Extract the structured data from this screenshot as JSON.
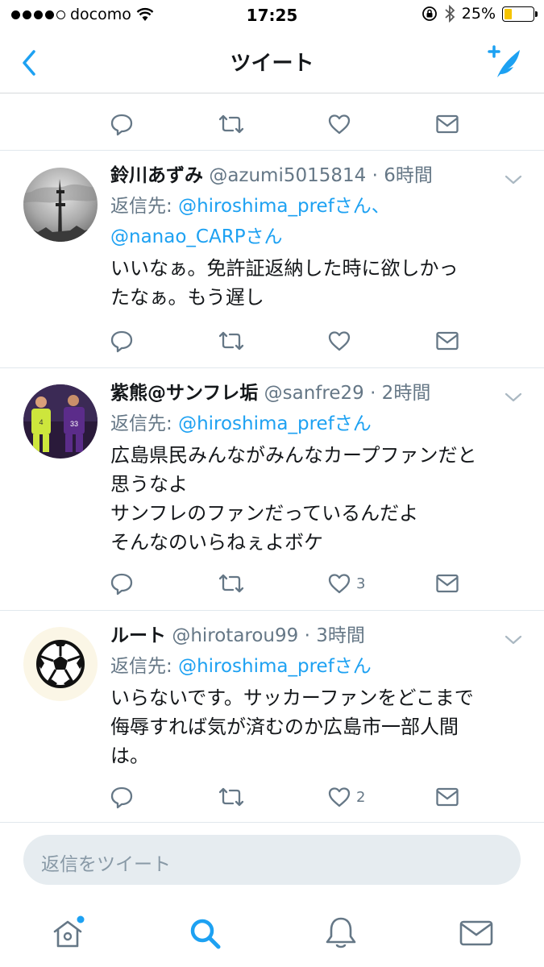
{
  "status_bar": {
    "carrier": "docomo",
    "time": "17:25",
    "battery": "25%",
    "battery_level": 0.25,
    "signal_bars": 4,
    "battery_color": "#f5c400"
  },
  "nav": {
    "title": "ツイート",
    "back_icon": "chevron-left-icon",
    "compose_icon": "compose-tweet-icon"
  },
  "colors": {
    "accent": "#1da1f2",
    "secondary_text": "#657786",
    "primary_text": "#14171a"
  },
  "tweets": [
    {
      "name": "鈴川あずみ",
      "handle": "@azumi5015814",
      "time": "· 6時間",
      "reply_prefix": "返信先: ",
      "reply_to_1": "@hiroshima_prefさん、",
      "reply_to_2": "@nanao_CARPさん",
      "text": "いいなぁ。免許証返納した時に欲しかっ\nたなぁ。もう遅し",
      "like_count": ""
    },
    {
      "name": "紫熊@サンフレ垢",
      "handle": "@sanfre29",
      "time": "· 2時間",
      "reply_prefix": "返信先: ",
      "reply_to_1": "@hiroshima_prefさん",
      "text": "広島県民みんながみんなカープファンだと\n思うなよ\nサンフレのファンだっているんだよ\nそんなのいらねぇよボケ",
      "like_count": "3"
    },
    {
      "name": "ルート",
      "handle": "@hirotarou99",
      "time": "· 3時間",
      "reply_prefix": "返信先: ",
      "reply_to_1": "@hiroshima_prefさん",
      "text": "いらないです。サッカーファンをどこまで\n侮辱すれば気が済むのか広島市一部人間\nは。",
      "like_count": "2"
    }
  ],
  "reply_box": {
    "placeholder": "返信をツイート"
  },
  "tab_bar": {
    "items": [
      "home-icon",
      "search-icon",
      "notifications-icon",
      "messages-icon"
    ],
    "active": "search-icon"
  }
}
